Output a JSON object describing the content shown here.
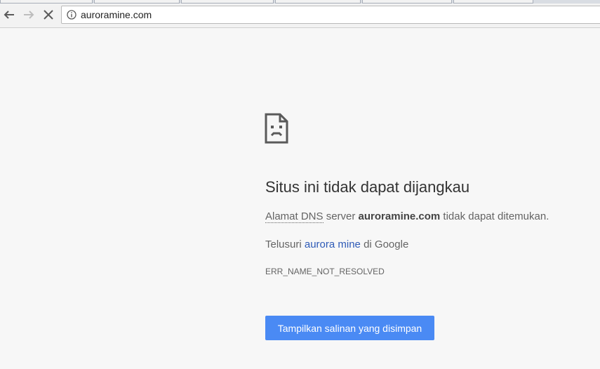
{
  "browser": {
    "url": "auroramine.com",
    "back_icon": "arrow-left-icon",
    "forward_icon": "arrow-right-icon",
    "stop_icon": "close-icon",
    "info_icon": "info-icon"
  },
  "error": {
    "icon": "sad-document-icon",
    "title": "Situs ini tidak dapat dijangkau",
    "dns_prefix_dotted": "Alamat DNS",
    "dns_server_word": " server ",
    "domain": "auroramine.com",
    "dns_suffix": " tidak dapat ditemukan.",
    "search_prefix": "Telusuri ",
    "search_link": "aurora mine",
    "search_suffix": " di Google",
    "code": "ERR_NAME_NOT_RESOLVED",
    "cached_button": "Tampilkan salinan yang disimpan"
  },
  "colors": {
    "background": "#f7f7f7",
    "button": "#4a8af4",
    "link": "#2f5bb7"
  }
}
